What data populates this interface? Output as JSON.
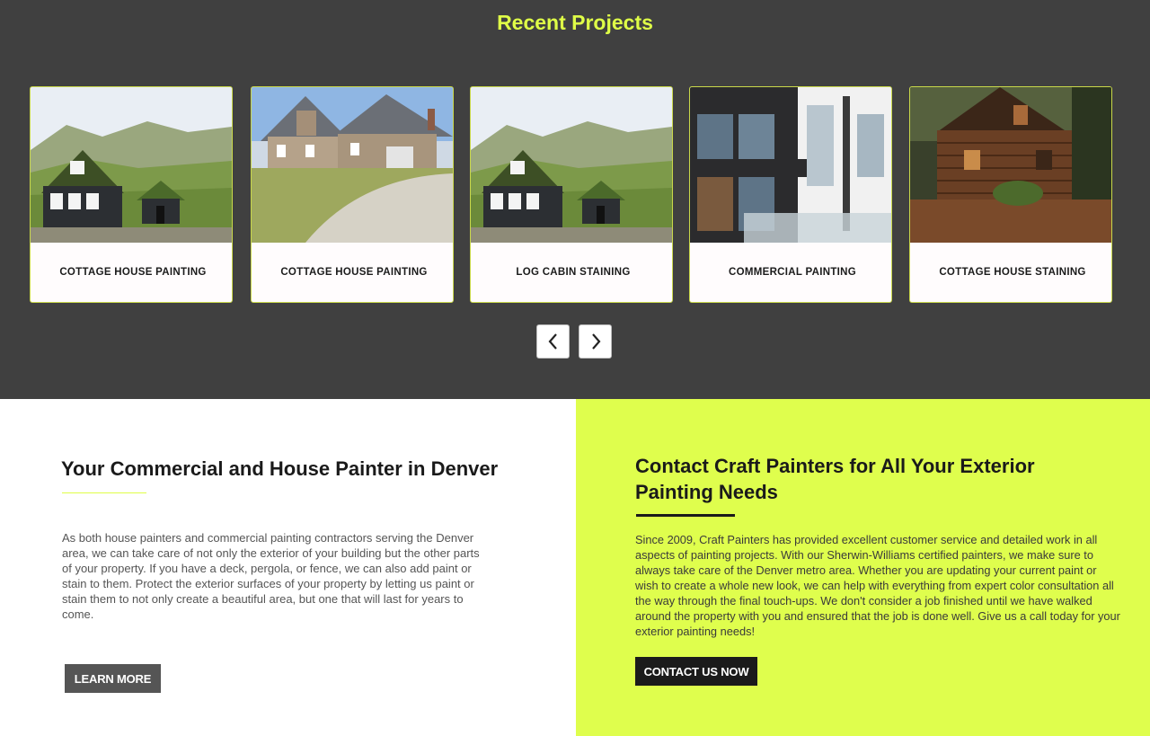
{
  "projects": {
    "title": "Recent Projects",
    "cards": [
      {
        "caption": "COTTAGE HOUSE PAINTING",
        "image": "cottage-house-photo"
      },
      {
        "caption": "COTTAGE HOUSE PAINTING",
        "image": "suburban-house-photo"
      },
      {
        "caption": "LOG CABIN STAINING",
        "image": "cottage-house-photo"
      },
      {
        "caption": "COMMERCIAL PAINTING",
        "image": "modern-building-photo"
      },
      {
        "caption": "COTTAGE HOUSE STAINING",
        "image": "log-cabin-photo"
      }
    ],
    "prev_icon": "chevron-left-icon",
    "next_icon": "chevron-right-icon"
  },
  "about": {
    "heading": "Your Commercial and House Painter in Denver",
    "body": "As both house painters and commercial painting contractors serving the Denver area, we can take care of not only the exterior of your building but the other parts of your property. If you have a deck, pergola, or fence, we can also add paint or stain to them. Protect the exterior surfaces of your property by letting us paint or stain them to not only create a beautiful area, but one that will last for years to come.",
    "button_label": "LEARN MORE"
  },
  "contact": {
    "heading": "Contact Craft Painters for All Your Exterior Painting Needs",
    "body": "Since 2009, Craft Painters has provided excellent customer service and detailed work in all aspects of painting projects. With our Sherwin-Williams certified painters, we make sure to always take care of the Denver metro area. Whether you are updating your current paint or wish to create a whole new look, we can help with everything from expert color consultation all the way through the final touch-ups. We don't consider a job finished until we have walked around the property with you and ensured that the job is done well. Give us a call today for your exterior painting needs!",
    "button_label": "CONTACT US NOW"
  },
  "colors": {
    "section_dark": "#404040",
    "accent": "#dffe47",
    "contact_bg": "#dffe4d",
    "button_gray": "#555555",
    "button_dark": "#1b1b1b"
  }
}
